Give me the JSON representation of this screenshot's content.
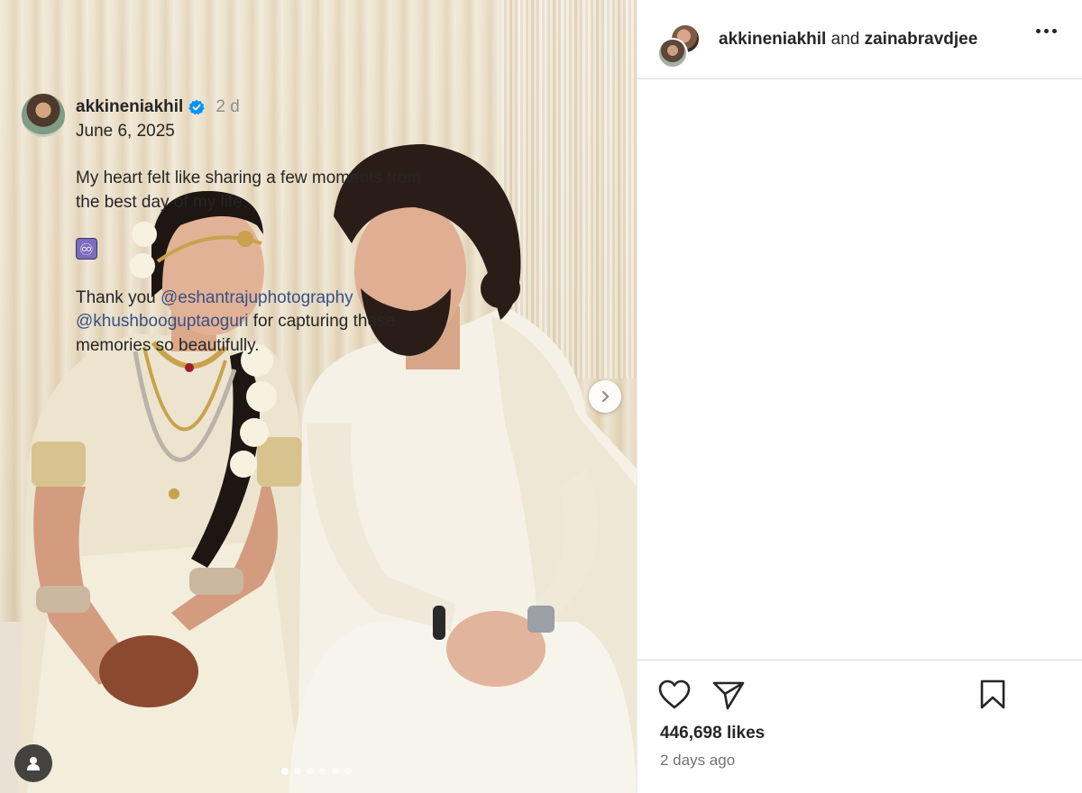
{
  "header": {
    "user1": "akkineniakhil",
    "joiner": "and",
    "user2": "zainabravdjee",
    "more_icon": "more-horizontal-icon"
  },
  "post": {
    "author": "akkineniakhil",
    "verified_icon": "verified-badge-icon",
    "age": "2 d",
    "date": "June 6, 2025",
    "caption_line1": "My heart felt like sharing a few moments from the best day of my life.",
    "emoji": "♾",
    "thanks_prefix": "Thank you ",
    "mention1": "@eshantrajuphotography",
    "mention2": "@khushbooguptaoguri",
    "thanks_suffix": " for capturing these memories so beautifully."
  },
  "media": {
    "next_icon": "chevron-right-icon",
    "tag_icon": "user-tag-icon",
    "carousel_count": 6,
    "carousel_active_index": 0
  },
  "actions": {
    "like_icon": "heart-icon",
    "share_icon": "send-icon",
    "save_icon": "bookmark-icon"
  },
  "stats": {
    "likes": "446,698 likes",
    "timestamp": "2 days ago"
  },
  "colors": {
    "link": "#385185",
    "verified": "#0095f6",
    "muted": "#8e8e8e"
  }
}
